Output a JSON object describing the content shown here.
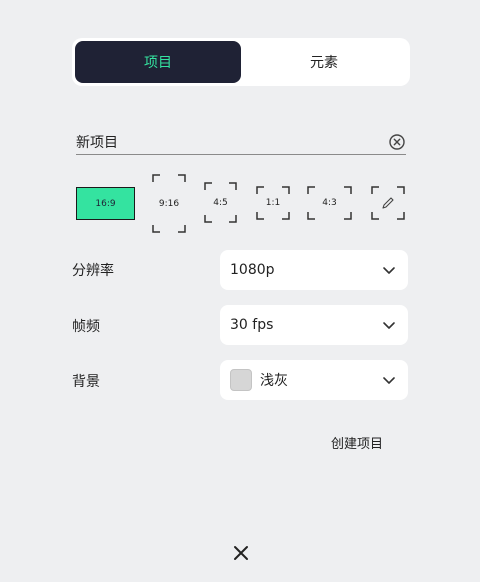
{
  "tabs": [
    {
      "label": "项目",
      "active": true
    },
    {
      "label": "元素",
      "active": false
    }
  ],
  "project_name": {
    "value": "新项目"
  },
  "ratios": [
    "16:9",
    "9:16",
    "4:5",
    "1:1",
    "4:3"
  ],
  "selected_ratio": "16:9",
  "settings": {
    "resolution": {
      "label": "分辨率",
      "value": "1080p"
    },
    "frame_rate": {
      "label": "帧频",
      "value": "30 fps"
    },
    "background": {
      "label": "背景",
      "value": "浅灰",
      "swatch_color": "#d6d6d6"
    }
  },
  "create_label": "创建项目",
  "colors": {
    "accent": "#34e3a0",
    "dark": "#1f2235",
    "page_bg": "#eeeff1"
  }
}
